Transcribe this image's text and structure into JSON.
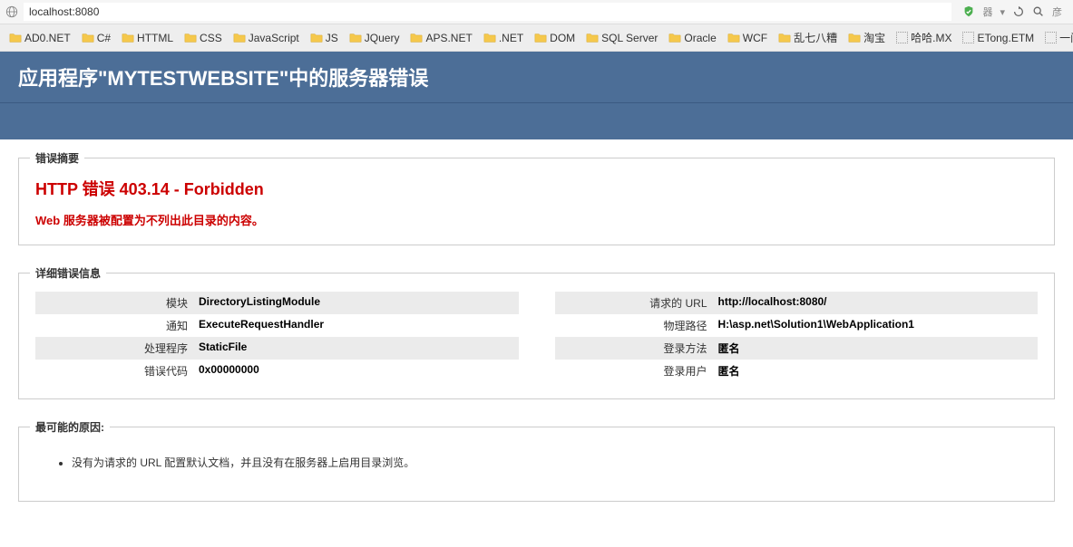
{
  "browser": {
    "address": "localhost:8080",
    "right_text": "器",
    "right_text2": "彦"
  },
  "bookmarks": [
    {
      "label": "AD0.NET",
      "type": "folder"
    },
    {
      "label": "C#",
      "type": "folder"
    },
    {
      "label": "HTTML",
      "type": "folder"
    },
    {
      "label": "CSS",
      "type": "folder"
    },
    {
      "label": "JavaScript",
      "type": "folder"
    },
    {
      "label": "JS",
      "type": "folder"
    },
    {
      "label": "JQuery",
      "type": "folder"
    },
    {
      "label": "APS.NET",
      "type": "folder"
    },
    {
      "label": ".NET",
      "type": "folder"
    },
    {
      "label": "DOM",
      "type": "folder"
    },
    {
      "label": "SQL Server",
      "type": "folder"
    },
    {
      "label": "Oracle",
      "type": "folder"
    },
    {
      "label": "WCF",
      "type": "folder"
    },
    {
      "label": "乱七八糟",
      "type": "folder"
    },
    {
      "label": "淘宝",
      "type": "folder"
    },
    {
      "label": "哈哈.MX",
      "type": "dotted"
    },
    {
      "label": "ETong.ETM",
      "type": "dotted"
    },
    {
      "label": "一问一答-H",
      "type": "dotted"
    }
  ],
  "error": {
    "header": "应用程序\"MYTESTWEBSITE\"中的服务器错误",
    "summary_label": "错误摘要",
    "http_title": "HTTP 错误 403.14 - Forbidden",
    "http_desc": "Web 服务器被配置为不列出此目录的内容。",
    "detail_label": "详细错误信息",
    "details_left": [
      {
        "label": "模块",
        "value": "DirectoryListingModule"
      },
      {
        "label": "通知",
        "value": "ExecuteRequestHandler"
      },
      {
        "label": "处理程序",
        "value": "StaticFile"
      },
      {
        "label": "错误代码",
        "value": "0x00000000"
      }
    ],
    "details_right": [
      {
        "label": "请求的 URL",
        "value": "http://localhost:8080/"
      },
      {
        "label": "物理路径",
        "value": "H:\\asp.net\\Solution1\\WebApplication1"
      },
      {
        "label": "登录方法",
        "value": "匿名"
      },
      {
        "label": "登录用户",
        "value": "匿名"
      }
    ],
    "cause_label": "最可能的原因:",
    "causes": [
      "没有为请求的 URL 配置默认文档，并且没有在服务器上启用目录浏览。"
    ]
  }
}
